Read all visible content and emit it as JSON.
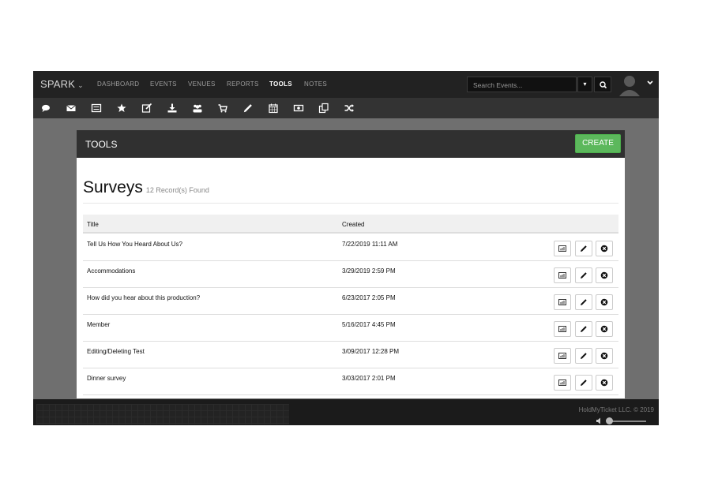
{
  "navbar": {
    "brand": "SPARK",
    "items": [
      {
        "label": "DASHBOARD",
        "active": false
      },
      {
        "label": "EVENTS",
        "active": false
      },
      {
        "label": "VENUES",
        "active": false
      },
      {
        "label": "REPORTS",
        "active": false
      },
      {
        "label": "TOOLS",
        "active": true
      },
      {
        "label": "NOTES",
        "active": false
      }
    ],
    "search_placeholder": "Search Events..."
  },
  "toolbar": {
    "icons": [
      "comment-icon",
      "envelope-icon",
      "list-icon",
      "star-icon",
      "edit-icon",
      "download-icon",
      "users-icon",
      "cart-icon",
      "pencil-icon",
      "calendar-icon",
      "money-icon",
      "copy-icon",
      "shuffle-icon"
    ]
  },
  "panel": {
    "title": "TOOLS",
    "create_label": "CREATE"
  },
  "page": {
    "title": "Surveys",
    "record_count": "12 Record(s) Found"
  },
  "table": {
    "columns": [
      "Title",
      "Created"
    ],
    "rows": [
      {
        "title": "Tell Us How You Heard About Us?",
        "created": "7/22/2019 11:11 AM"
      },
      {
        "title": "Accommodations",
        "created": "3/29/2019 2:59 PM"
      },
      {
        "title": "How did you hear about this production?",
        "created": "6/23/2017 2:05 PM"
      },
      {
        "title": "Member",
        "created": "5/16/2017 4:45 PM"
      },
      {
        "title": "Editing/Deleting Test",
        "created": "3/09/2017 12:28 PM"
      },
      {
        "title": "Dinner survey",
        "created": "3/03/2017 2:01 PM"
      }
    ]
  },
  "footer": {
    "copyright": "HoldMyTicket LLC. © 2019"
  },
  "colors": {
    "navbar": "#222222",
    "toolbar": "#333333",
    "create": "#5cb85c"
  }
}
